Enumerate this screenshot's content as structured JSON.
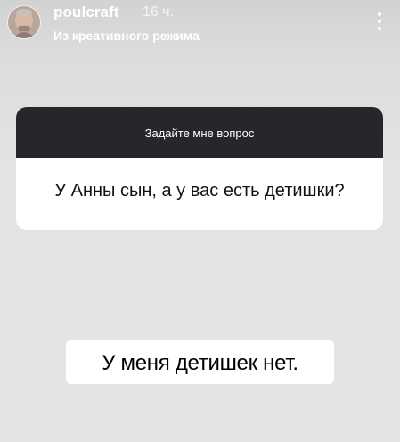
{
  "story": {
    "username": "poulcraft",
    "time": "16 ч.",
    "subtitle": "Из креативного режима"
  },
  "question_sticker": {
    "prompt": "Задайте мне вопрос",
    "question": "У Анны сын, а у вас есть детишки?"
  },
  "answer": {
    "text": "У меня детишек нет."
  },
  "icons": {
    "avatar": "user-avatar",
    "more": "more-vertical-icon"
  }
}
